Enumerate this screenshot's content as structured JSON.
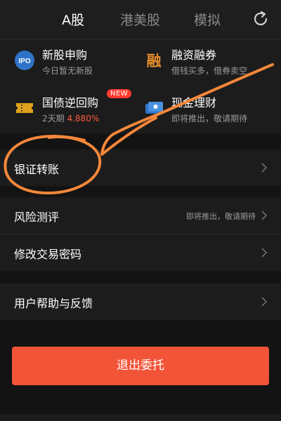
{
  "header": {
    "tabs": [
      {
        "label": "A股",
        "active": true
      },
      {
        "label": "港美股",
        "active": false
      },
      {
        "label": "模拟",
        "active": false
      }
    ],
    "refresh_icon": "refresh-icon"
  },
  "features": [
    {
      "icon_text": "IPO",
      "title": "新股申购",
      "subtitle": "今日暂无新股"
    },
    {
      "icon_text": "融",
      "title": "融资融券",
      "subtitle": "借钱买多，借券卖空"
    },
    {
      "title": "国债逆回购",
      "badge": "NEW",
      "subtitle_prefix": "2天期",
      "subtitle_value": "4.880%"
    },
    {
      "title": "现金理财",
      "subtitle": "即将推出，敬请期待"
    }
  ],
  "menu": [
    {
      "label": "银证转账"
    },
    {
      "label": "风险测评",
      "hint": "即将推出，敬请期待"
    },
    {
      "label": "修改交易密码"
    },
    {
      "label": "用户帮助与反馈"
    }
  ],
  "logout_label": "退出委托",
  "colors": {
    "accent": "#f25438",
    "new_badge": "#ff3b2f",
    "rate_red": "#ff5a3c",
    "annotation": "#f5873a"
  }
}
